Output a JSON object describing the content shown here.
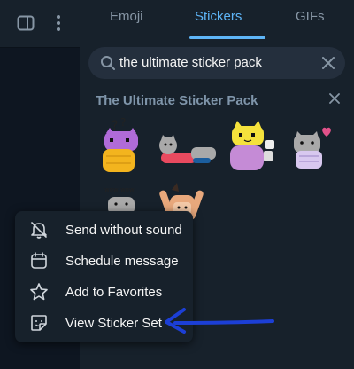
{
  "tabs": [
    {
      "label": "Emoji"
    },
    {
      "label": "Stickers"
    },
    {
      "label": "GIFs"
    }
  ],
  "search": {
    "value": "the ultimate sticker pack"
  },
  "sticker_set": {
    "title": "The Ultimate Sticker Pack"
  },
  "context_menu": {
    "items": [
      {
        "label": "Send without sound",
        "icon": "bell-off-icon"
      },
      {
        "label": "Schedule message",
        "icon": "calendar-icon"
      },
      {
        "label": "Add to Favorites",
        "icon": "star-icon"
      },
      {
        "label": "View Sticker Set",
        "icon": "sticker-icon"
      }
    ]
  },
  "colors": {
    "background": "#17212b",
    "accent": "#5eb5f7",
    "annotation_arrow": "#1c3fd6"
  }
}
